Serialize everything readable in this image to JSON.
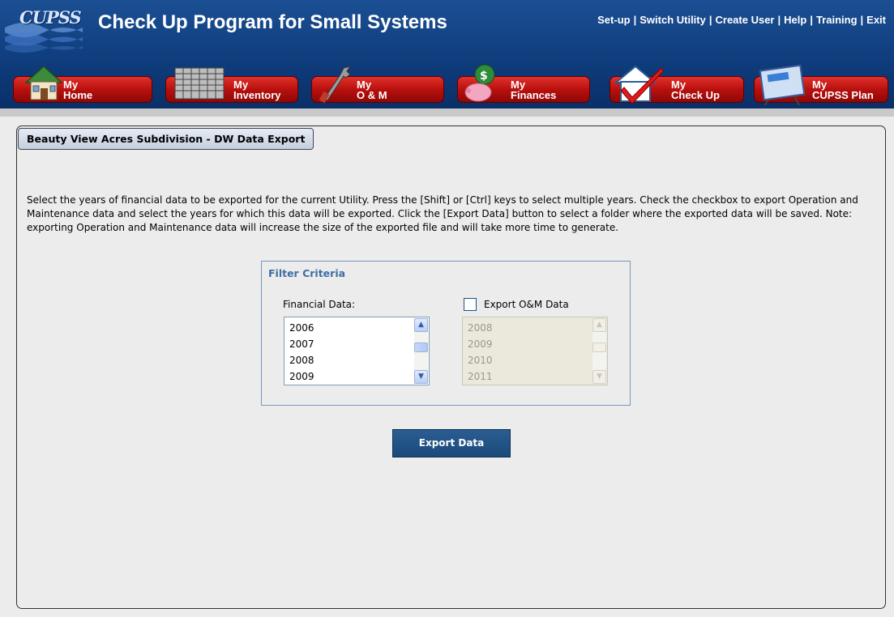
{
  "header": {
    "logo_text": "CUPSS",
    "title": "Check Up Program for Small Systems",
    "links": [
      "Set-up",
      "Switch Utility",
      "Create User",
      "Help",
      "Training",
      "Exit"
    ]
  },
  "nav": [
    {
      "line1": "My",
      "line2": "Home",
      "icon": "house-icon"
    },
    {
      "line1": "My",
      "line2": "Inventory",
      "icon": "pipes-stack-icon"
    },
    {
      "line1": "My",
      "line2": "O & M",
      "icon": "wrench-icon"
    },
    {
      "line1": "My",
      "line2": "Finances",
      "icon": "piggy-bank-icon"
    },
    {
      "line1": "My",
      "line2": "Check Up",
      "icon": "checkmark-house-icon"
    },
    {
      "line1": "My",
      "line2": "CUPSS Plan",
      "icon": "plan-easel-icon"
    }
  ],
  "panel": {
    "tab_title": "Beauty View Acres Subdivision - DW Data Export",
    "instructions": "Select the years of financial data to be exported for the current Utility. Press the [Shift] or [Ctrl] keys to select multiple years. Check the checkbox to export Operation and Maintenance data and select the years for which this data will be exported. Click the [Export Data] button to select a folder where the exported data will be saved.  Note: exporting Operation and Maintenance data will increase the size of the exported file and will take more time to generate."
  },
  "filter": {
    "title": "Filter Criteria",
    "financial_label": "Financial Data:",
    "financial_years": [
      "2006",
      "2007",
      "2008",
      "2009"
    ],
    "om_label": "Export O&M Data",
    "om_checked": false,
    "om_years": [
      "2008",
      "2009",
      "2010",
      "2011"
    ]
  },
  "actions": {
    "export_label": "Export Data"
  },
  "colors": {
    "header_blue": "#0f3d7d",
    "nav_red": "#b8100e",
    "filter_title": "#3e6ea3",
    "button_blue": "#1b4a7a"
  }
}
